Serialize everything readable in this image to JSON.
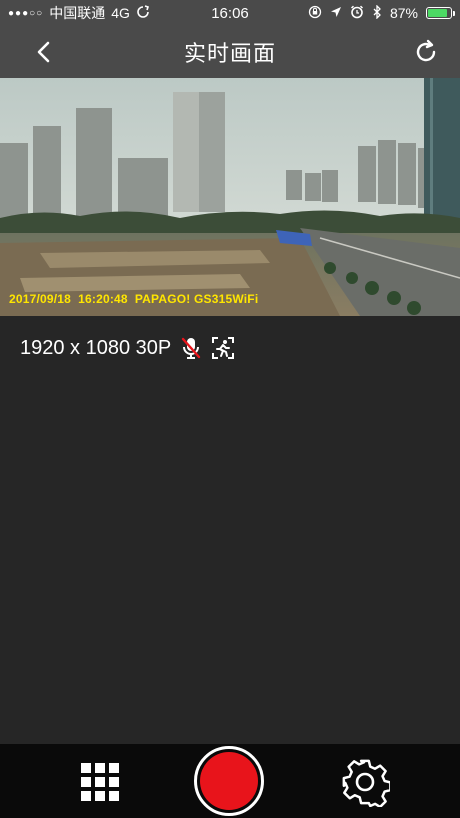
{
  "status_bar": {
    "carrier": "中国联通",
    "network": "4G",
    "time": "16:06",
    "battery_percent": "87%",
    "battery_level": 0.87
  },
  "nav": {
    "title": "实时画面"
  },
  "video": {
    "osd_text": "2017/09/18  16:20:48  PAPAGO! GS315WiFi"
  },
  "info": {
    "resolution": "1920 x 1080 30P"
  },
  "colors": {
    "bar_bg": "#4a4a4a",
    "content_bg": "#262626",
    "bottom_bg": "#0a0a0a",
    "osd": "#ffe600",
    "record": "#e8141b",
    "mic_off": "#e8141b",
    "battery": "#4cd964"
  },
  "icons": {
    "back": "chevron-left-icon",
    "refresh": "refresh-icon",
    "mic": "microphone-muted-icon",
    "motion": "motion-detection-icon",
    "grid": "grid-icon",
    "record": "record-icon",
    "settings": "gear-icon"
  }
}
